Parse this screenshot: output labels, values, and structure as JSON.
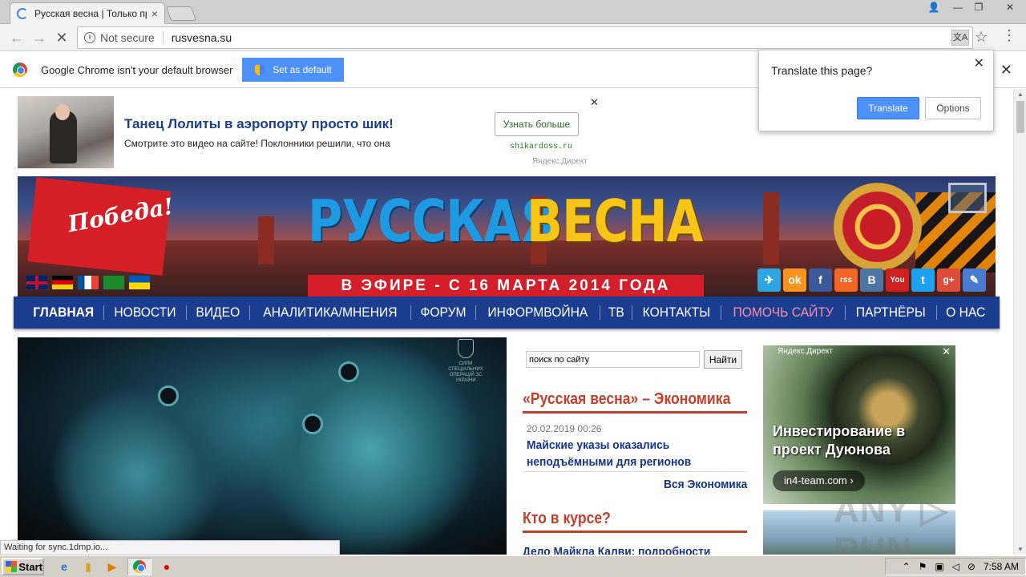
{
  "browser": {
    "tab_title": "Русская весна | Только пр",
    "tab_close": "×",
    "url_security": "Not secure",
    "url": "rusvesna.su",
    "window_controls": {
      "user": "👤",
      "minimize": "—",
      "restore": "❐",
      "close": "✕"
    },
    "back": "←",
    "forward": "→",
    "stop": "✕",
    "translate_icon": "文A",
    "bookmark_star": "☆",
    "menu_dots": "⋮"
  },
  "infobar": {
    "message": "Google Chrome isn't your default browser",
    "button": "Set as default",
    "close": "✕"
  },
  "translate_bubble": {
    "question": "Translate this page?",
    "translate": "Translate",
    "options": "Options",
    "close": "✕"
  },
  "top_ad": {
    "title": "Танец Лолиты в аэропорту просто шик!",
    "text": "Смотрите это видео на сайте! Поклонники решили, что она",
    "button": "Узнать больше",
    "domain": "shikardoss.ru",
    "close": "✕",
    "network": "Яндекс.Директ"
  },
  "banner": {
    "pobeda": "Победа!",
    "title_part1": "РУССКАЯ",
    "title_part2": "ВЕСНА",
    "strip": "В ЭФИРЕ - С 16 МАРТА 2014 ГОДА",
    "social": [
      "✈",
      "ok",
      "f",
      "rss",
      "B",
      "You",
      "t",
      "g+",
      "✎"
    ]
  },
  "nav": {
    "items": [
      "ГЛАВНАЯ",
      "НОВОСТИ",
      "ВИДЕО",
      "АНАЛИТИКА/МНЕНИЯ",
      "ФОРУМ",
      "ИНФОРМВОЙНА",
      "ТВ",
      "КОНТАКТЫ",
      "ПОМОЧЬ САЙТУ",
      "ПАРТНЁРЫ",
      "О НАС"
    ]
  },
  "hero": {
    "badge_text": "СИЛИ СПЕЦІАЛЬНИХ ОПЕРАЦІЙ ЗС УКРАЇНИ"
  },
  "sidebar": {
    "search_value": "поиск по сайту",
    "search_button": "Найти",
    "economy_title": "«Русская весна» – Экономика",
    "economy_date": "20.02.2019 00:26",
    "economy_headline": "Майские указы оказались неподъёмными для регионов",
    "economy_all": "Вся Экономика",
    "kto_title": "Кто в курсе?",
    "kto_headline": "Дело Майкла Калви: подробности"
  },
  "right_ad": {
    "network": "Яндекс.Директ",
    "close": "✕",
    "headline": "Инвестирование в проект Дуюнова",
    "pill": "in4-team.com ›"
  },
  "watermark": "ANY ▷ RUN",
  "status_text": "Waiting for sync.1dmp.io...",
  "taskbar": {
    "start": "Start",
    "clock": "7:58 AM"
  }
}
